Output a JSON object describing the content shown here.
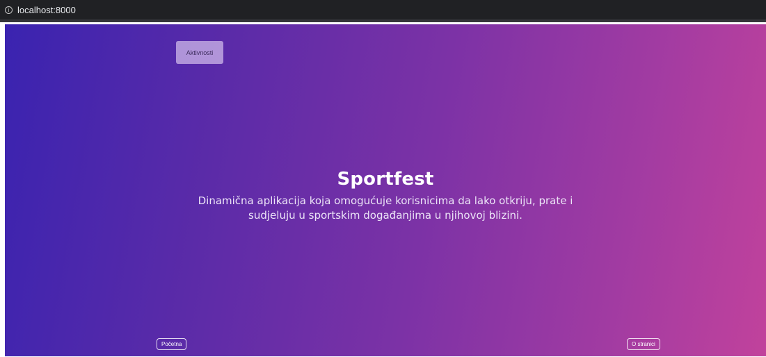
{
  "browser": {
    "url": "localhost:8000"
  },
  "nav": {
    "activities_label": "Aktivnosti"
  },
  "hero": {
    "title": "Sportfest",
    "description": "Dinamična aplikacija koja omogućuje korisnicima da lako otkriju, prate i sudjeluju u sportskim događanjima u njihovoj blizini."
  },
  "footer": {
    "home_label": "Početna",
    "about_label": "O stranici"
  },
  "colors": {
    "gradient_start": "#3a23b0",
    "gradient_end": "#c1429c",
    "browser_bar": "#202124"
  }
}
